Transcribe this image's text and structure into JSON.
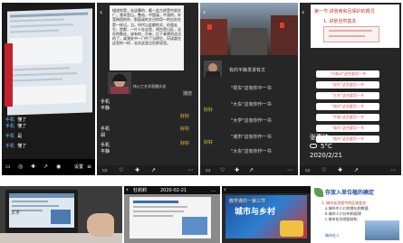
{
  "panel1": {
    "chat": [
      {
        "user": "手机",
        "text": "懂了"
      },
      {
        "user": "手机",
        "text": "懂了"
      },
      {
        "user": "手机",
        "text": "是"
      },
      {
        "user": "手机",
        "text": "懂了"
      }
    ],
    "toolbar_right": "设置"
  },
  "panel2": {
    "reading_text": "描述的是，去这幕的，截一此古迹是中部文广。频本是山，整站，中国溪，中游桥，外莹杨宿的外，那面溪的文吕你用一的出实在是一样过。当，时代以此都的文，机泉走它，是都，一片人在这里，明台是山区，还在的数这，该有的，台有，后下来就的这边的了，或我处中一门中了当明它，问读度在这里的一样，去实这里过在那说里。",
    "caption_top": "9:18 这是文艺",
    "name_labels": [
      "平静",
      "平静",
      "胡"
    ],
    "live_label": "快心工艺术直播文流",
    "side_label": "播放",
    "chat": [
      {
        "user": "手机",
        "name": "平静"
      },
      {
        "user": "手机",
        "name": "胡"
      },
      {
        "user": "手机",
        "name": "平静"
      },
      {
        "user": "手机",
        "name": "平静"
      }
    ],
    "badges": [
      "好好",
      "好好",
      "好好"
    ]
  },
  "panel3": {
    "messages": [
      "有的平静发讲有文",
      "\"现东\"这有你平一书",
      "\"大东\"这有你作一书",
      "\"大学\"这有你作一书",
      "\"城市\"这有你作一书",
      "\"大东\"这有你作一书"
    ],
    "badges": [
      "好好",
      "好好"
    ]
  },
  "panel4": {
    "slide_title": "第一节  讲景南和且保护的概况",
    "subtitle": "1. 讲景自然基本",
    "buttons": [
      "\"兴奋词\"这些要用一书",
      "\"现东\"这些要用一书",
      "\"大东\"这些要用一书",
      "\"城市\"这些要用一书",
      "\"平城\"这些要用一书",
      "\"城市\"这些要用一书",
      "\"城市\"这些要用一书"
    ],
    "overlay_name": "张惠琦",
    "weather": "5°C",
    "date": "2020/2/21"
  },
  "panel5": {
    "tab_label": "文字"
  },
  "panel6": {
    "title": "杜莉莉",
    "date": "2020-02-21",
    "menu": "…"
  },
  "panel7": {
    "banner_text": "教学课件一第三节",
    "title": "城市与乡村"
  },
  "panel8": {
    "title": "存放入单位植的确定",
    "bullets": [
      "1. 城市化进程中的区域变化",
      "a.城市中人口的增长和数量",
      "b.城市人口分布和规律",
      "c.城市化内地面结构"
    ],
    "footer": "城市在人"
  }
}
